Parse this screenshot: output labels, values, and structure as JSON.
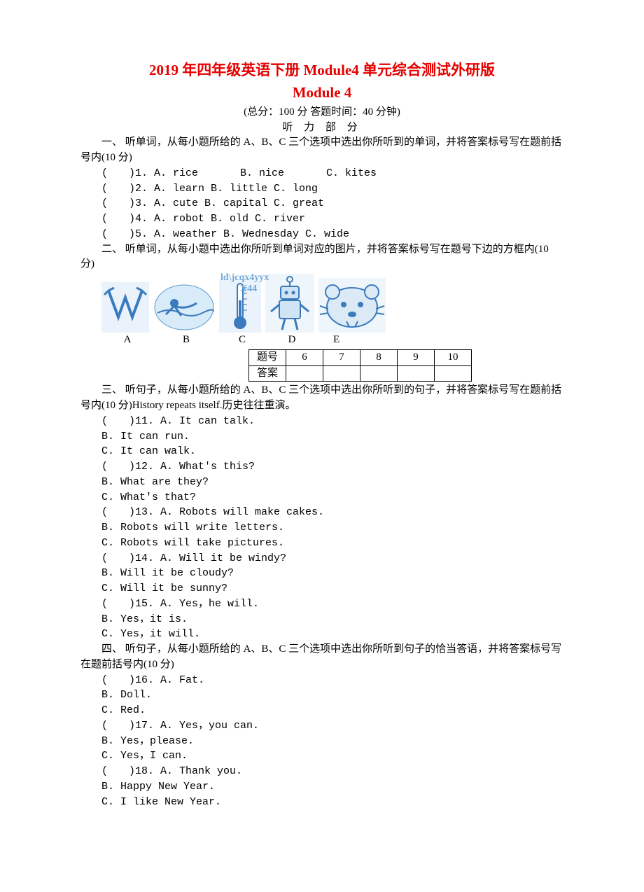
{
  "title_main": "2019 年四年级英语下册 Module4 单元综合测试外研版",
  "title_sub": "Module 4",
  "meta": "(总分：100 分   答题时间：40 分钟)",
  "listening_label": "听 力 部 分",
  "sec1": {
    "intro": "一、 听单词，从每小题所给的 A、B、C 三个选项中选出你所听到的单词，并将答案标号写在题前括号内(10 分)",
    "items": [
      "(　　)1. A. rice　　　　B. nice　　　　C. kites",
      "(　　)2. A. learn   B. little   C. long",
      "(　　)3. A. cute   B. capital   C. great",
      "(　　)4. A. robot   B. old   C. river",
      "(　　)5. A. weather   B. Wednesday   C. wide"
    ]
  },
  "sec2": {
    "intro": "二、 听单词，从每小题中选出你所听到单词对应的图片，并将答案标号写在题号下边的方框内(10 分)",
    "labels": [
      "A",
      "B",
      "C",
      "D",
      "E"
    ],
    "watermark1": "ld\\jcqx4yyx",
    "watermark2": "X44",
    "table_header": "题号",
    "table_cols": [
      "6",
      "7",
      "8",
      "9",
      "10"
    ],
    "table_answer_label": "答案"
  },
  "sec3": {
    "intro": "三、 听句子，从每小题所给的 A、B、C 三个选项中选出你所听到的句子，并将答案标号写在题前括号内(10 分)History repeats itself.历史往往重演。",
    "items": [
      "(　　)11. A. It can talk.",
      "B. It can run.",
      "C. It can walk.",
      "(　　)12. A. What's this?",
      "B. What are they?",
      "C. What's that?",
      "(　　)13. A. Robots will make cakes.",
      "B. Robots will write letters.",
      "C. Robots will take pictures.",
      "(　　)14. A. Will it be windy?",
      "B. Will it be cloudy?",
      "C. Will it be sunny?",
      "(　　)15. A. Yes，he will.",
      "B. Yes，it is.",
      "C. Yes，it will."
    ]
  },
  "sec4": {
    "intro": "四、 听句子，从每小题所给的 A、B、C 三个选项中选出你所听到句子的恰当答语，并将答案标号写在题前括号内(10 分)",
    "items": [
      "(　　)16. A. Fat.",
      "B. Doll.",
      "C. Red.",
      "(　　)17. A. Yes，you can.",
      "B. Yes，please.",
      "C. Yes，I can.",
      "(　　)18. A. Thank you.",
      "B. Happy New Year.",
      "C. I like New Year."
    ]
  }
}
